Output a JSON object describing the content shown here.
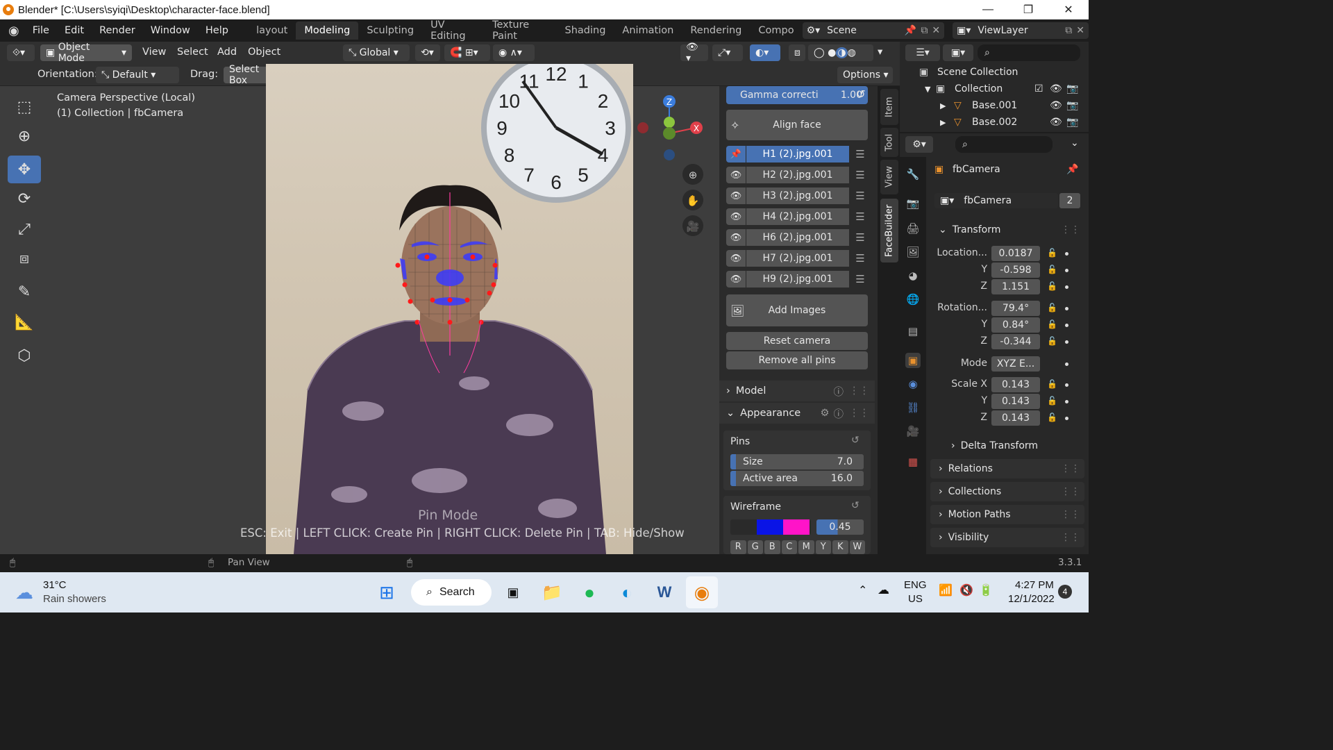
{
  "window": {
    "title": "Blender* [C:\\Users\\syiqi\\Desktop\\character-face.blend]"
  },
  "menu": {
    "items": [
      "File",
      "Edit",
      "Render",
      "Window",
      "Help"
    ]
  },
  "workspaces": {
    "tabs": [
      "layout",
      "Modeling",
      "Sculpting",
      "UV Editing",
      "Texture Paint",
      "Shading",
      "Animation",
      "Rendering",
      "Compo"
    ],
    "active": "Modeling"
  },
  "scene": {
    "label": "Scene",
    "view_layer": "ViewLayer"
  },
  "header": {
    "mode": "Object Mode",
    "menus": [
      "View",
      "Select",
      "Add",
      "Object"
    ],
    "transform": "Global",
    "orientation_label": "Orientation:",
    "orientation_value": "Default",
    "drag_label": "Drag:",
    "drag_value": "Select Box",
    "options": "Options"
  },
  "viewport": {
    "info_line1": "Camera Perspective (Local)",
    "info_line2": "(1) Collection | fbCamera",
    "pin_mode_title": "Pin Mode",
    "pin_mode_hint": "ESC: Exit | LEFT CLICK: Create Pin | RIGHT CLICK: Delete Pin | TAB: Hide/Show",
    "clock_numbers": [
      "12",
      "1",
      "2",
      "3",
      "4",
      "5",
      "6",
      "7",
      "8",
      "9",
      "10",
      "11"
    ]
  },
  "facebuilder": {
    "gamma_label": "Gamma correcti",
    "gamma_value": "1.00",
    "align_face": "Align face",
    "images": [
      "H1 (2).jpg.001",
      "H2 (2).jpg.001",
      "H3 (2).jpg.001",
      "H4 (2).jpg.001",
      "H6 (2).jpg.001",
      "H7 (2).jpg.001",
      "H9 (2).jpg.001"
    ],
    "active_image": "H1 (2).jpg.001",
    "add_images": "Add Images",
    "reset_camera": "Reset camera",
    "remove_all_pins": "Remove all pins",
    "model_section": "Model",
    "appearance_section": "Appearance",
    "pins_label": "Pins",
    "size_label": "Size",
    "size_value": "7.0",
    "active_area_label": "Active area",
    "active_area_value": "16.0",
    "wireframe_label": "Wireframe",
    "wireframe_opacity": "0.45",
    "wireframe_color_a": "#0a14e6",
    "wireframe_color_b": "#ff14c8",
    "channel_buttons": [
      "R",
      "G",
      "B",
      "C",
      "M",
      "Y",
      "K",
      "W"
    ]
  },
  "sidebar_tabs": [
    "Item",
    "Tool",
    "View",
    "FaceBuilder"
  ],
  "outliner": {
    "root": "Scene Collection",
    "collection": "Collection",
    "items": [
      "Base.001",
      "Base.002"
    ]
  },
  "properties": {
    "object_name": "fbCamera",
    "data_name": "fbCamera",
    "users": "2",
    "transform_label": "Transform",
    "location_label": "Location...",
    "location": [
      "0.0187",
      "-0.598",
      "1.151"
    ],
    "rotation_label": "Rotation...",
    "rotation": [
      "79.4°",
      "0.84°",
      "-0.344"
    ],
    "mode_label": "Mode",
    "mode_value": "XYZ E...",
    "scale_label": "Scale X",
    "scale": [
      "0.143",
      "0.143",
      "0.143"
    ],
    "axis_y": "Y",
    "axis_z": "Z",
    "sections": [
      "Delta Transform",
      "Relations",
      "Collections",
      "Motion Paths",
      "Visibility"
    ]
  },
  "statusbar": {
    "pan_view": "Pan View",
    "version": "3.3.1"
  },
  "taskbar": {
    "weather_temp": "31°C",
    "weather_desc": "Rain showers",
    "search": "Search",
    "lang1": "ENG",
    "lang2": "US",
    "time": "4:27 PM",
    "date": "12/1/2022",
    "notifications": "4"
  }
}
